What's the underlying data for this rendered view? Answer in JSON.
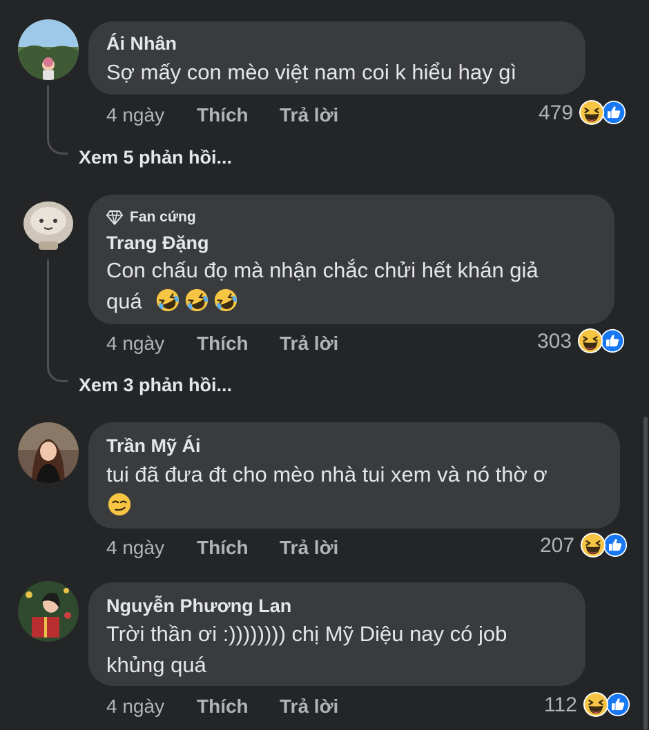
{
  "comments": [
    {
      "author": "Ái Nhân",
      "text": "Sợ mấy con mèo việt nam coi k hiểu hay gì",
      "time": "4 ngày",
      "like_label": "Thích",
      "reply_label": "Trả lời",
      "reaction_count": "479",
      "reaction_icons": [
        "haha-icon",
        "like-icon"
      ],
      "view_replies": "Xem 5 phản hồi..."
    },
    {
      "badge": "Fan cứng",
      "badge_icon": "diamond-icon",
      "author": "Trang Đặng",
      "text_line1": "Con chấu đọ mà nhận chắc chửi hết khán giả",
      "text_line2": "quá",
      "emojis": [
        "rofl-emoji",
        "rofl-emoji",
        "rofl-emoji"
      ],
      "time": "4 ngày",
      "like_label": "Thích",
      "reply_label": "Trả lời",
      "reaction_count": "303",
      "reaction_icons": [
        "haha-icon",
        "like-icon"
      ],
      "view_replies": "Xem 3 phản hồi..."
    },
    {
      "author": "Trần Mỹ Ái",
      "text": "tui đã đưa đt cho mèo nhà tui xem và nó thờ ơ",
      "emojis": [
        "smirk-emoji"
      ],
      "time": "4 ngày",
      "like_label": "Thích",
      "reply_label": "Trả lời",
      "reaction_count": "207",
      "reaction_icons": [
        "haha-icon",
        "like-icon"
      ]
    },
    {
      "author": "Nguyễn Phương Lan",
      "text_line1": "Trời thần ơi :)))))))) chị Mỹ Diệu nay có job",
      "text_line2": "khủng quá",
      "time": "4 ngày",
      "like_label": "Thích",
      "reply_label": "Trả lời",
      "reaction_count": "112",
      "reaction_icons": [
        "haha-icon",
        "like-icon"
      ]
    }
  ],
  "colors": {
    "background": "#242526",
    "bubble": "#3a3b3c",
    "text": "#e4e6eb",
    "secondary": "#b0b3b8",
    "like_blue": "#1877f2",
    "haha_yellow": "#f7c544"
  }
}
